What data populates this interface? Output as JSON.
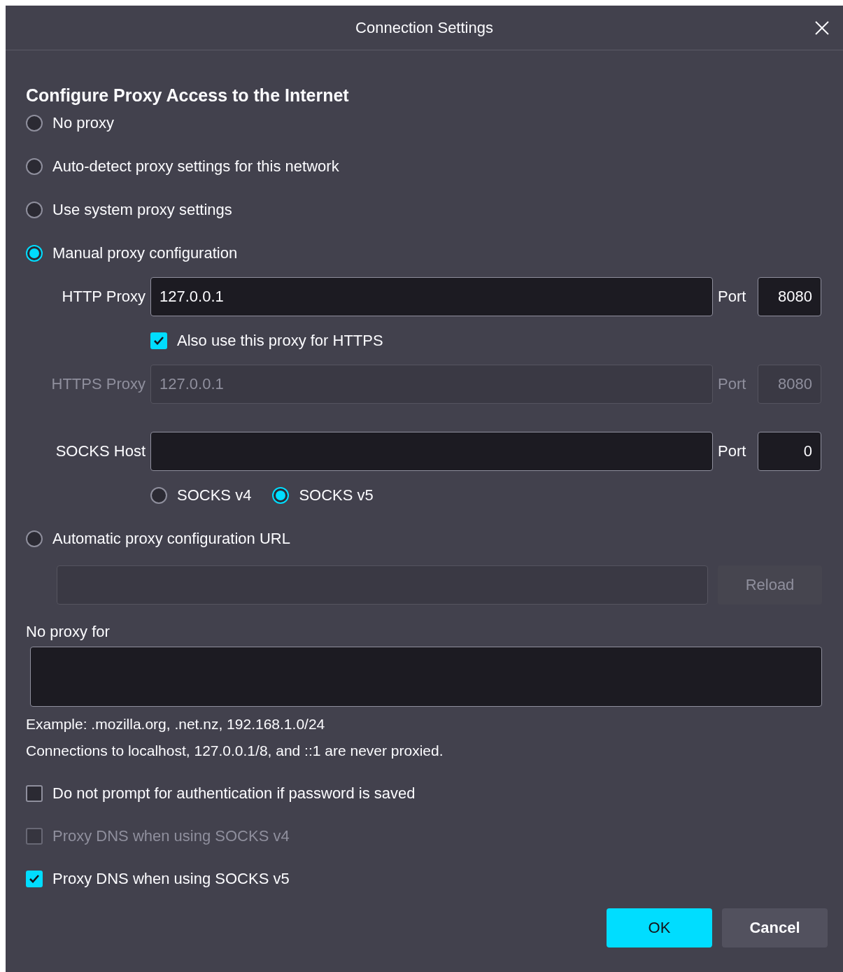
{
  "dialog": {
    "title": "Connection Settings"
  },
  "heading": "Configure Proxy Access to the Internet",
  "proxy_modes": [
    {
      "label": "No proxy",
      "selected": false
    },
    {
      "label": "Auto-detect proxy settings for this network",
      "selected": false
    },
    {
      "label": "Use system proxy settings",
      "selected": false
    },
    {
      "label": "Manual proxy configuration",
      "selected": true
    }
  ],
  "http_proxy": {
    "label": "HTTP Proxy",
    "value": "127.0.0.1",
    "port_label": "Port",
    "port": "8080",
    "disabled": false
  },
  "also_https": {
    "label": "Also use this proxy for HTTPS",
    "checked": true
  },
  "https_proxy": {
    "label": "HTTPS Proxy",
    "value": "127.0.0.1",
    "port_label": "Port",
    "port": "8080",
    "disabled": true
  },
  "socks": {
    "label": "SOCKS Host",
    "port_label": "Port",
    "port": "0",
    "disabled": false
  },
  "socks_versions": [
    {
      "label": "SOCKS v4",
      "selected": false
    },
    {
      "label": "SOCKS v5",
      "selected": true
    }
  ],
  "auto_url": {
    "label": "Automatic proxy configuration URL",
    "selected": false,
    "field_disabled": true
  },
  "reload": {
    "label": "Reload",
    "disabled": true
  },
  "no_proxy_for": {
    "label": "No proxy for"
  },
  "hints": [
    "Example: .mozilla.org, .net.nz, 192.168.1.0/24",
    "Connections to localhost, 127.0.0.1/8, and ::1 are never proxied."
  ],
  "options": [
    {
      "label": "Do not prompt for authentication if password is saved",
      "checked": false,
      "disabled": false
    },
    {
      "label": "Proxy DNS when using SOCKS v4",
      "checked": false,
      "disabled": true
    },
    {
      "label": "Proxy DNS when using SOCKS v5",
      "checked": true,
      "disabled": false
    }
  ],
  "buttons": [
    {
      "label": "OK",
      "kind": "primary"
    },
    {
      "label": "Cancel",
      "kind": "secondary"
    }
  ]
}
